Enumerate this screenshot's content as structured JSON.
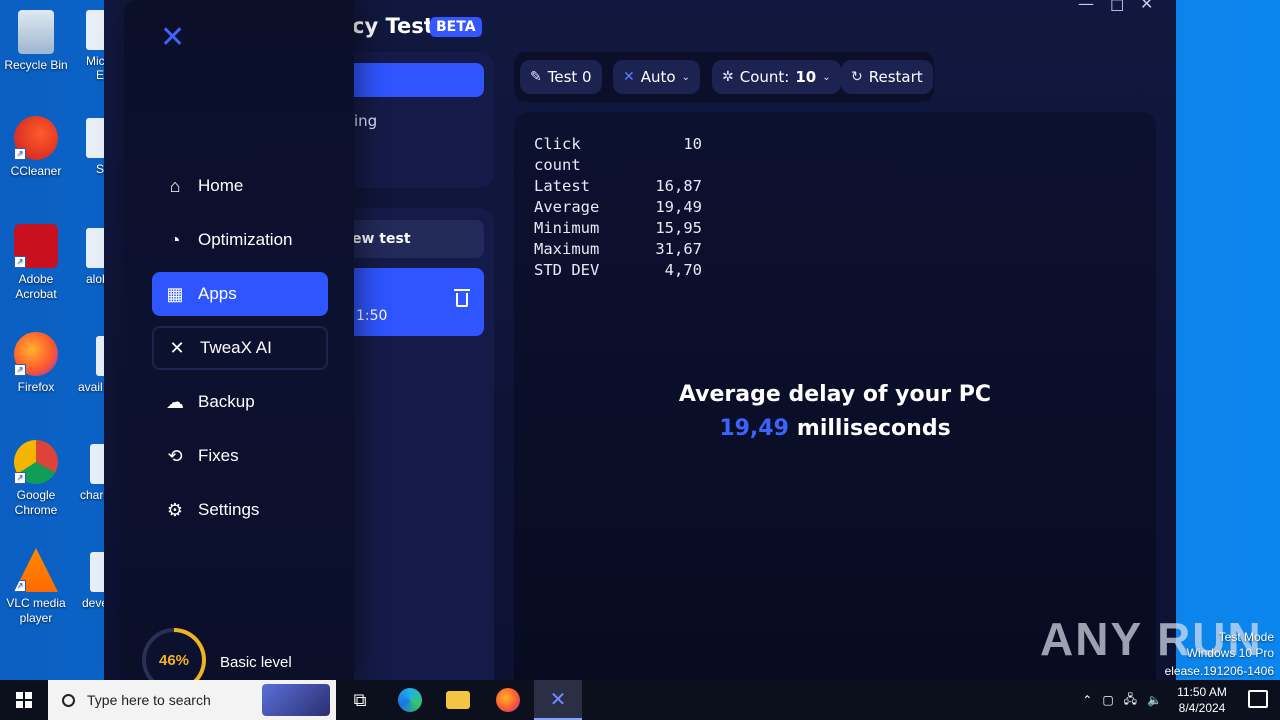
{
  "desktop": {
    "icons": [
      {
        "label": "Recycle Bin"
      },
      {
        "label": "CCleaner"
      },
      {
        "label": "Adobe Acrobat"
      },
      {
        "label": "Firefox"
      },
      {
        "label": "Google Chrome"
      },
      {
        "label": "VLC media player"
      }
    ],
    "partials": [
      "Mic",
      "E",
      "Sl",
      "alob",
      "avail",
      "charg",
      "deve"
    ]
  },
  "app": {
    "title_fragment": "cy Test",
    "beta": "BETA",
    "left_fragment_1": "ing",
    "new_test_fragment": "ew test",
    "test_time_fragment": "1:50",
    "toolbar": {
      "test": "Test 0",
      "auto": "Auto",
      "count_label": "Count:",
      "count_value": "10",
      "restart": "Restart"
    },
    "stats": [
      {
        "k": "Click count",
        "v": "10"
      },
      {
        "k": "Latest",
        "v": "16,87"
      },
      {
        "k": "Average",
        "v": "19,49"
      },
      {
        "k": "Minimum",
        "v": "15,95"
      },
      {
        "k": "Maximum",
        "v": "31,67"
      },
      {
        "k": "STD DEV",
        "v": "4,70"
      }
    ],
    "avg_title": "Average delay of your PC",
    "avg_value": "19,49",
    "avg_unit": "milliseconds"
  },
  "sidebar": {
    "items": [
      {
        "label": "Home",
        "icon": "home-icon"
      },
      {
        "label": "Optimization",
        "icon": "speedometer-icon"
      },
      {
        "label": "Apps",
        "icon": "apps-grid-icon"
      },
      {
        "label": "TweaX AI",
        "icon": "tweax-logo-icon"
      },
      {
        "label": "Backup",
        "icon": "cloud-upload-icon"
      },
      {
        "label": "Fixes",
        "icon": "history-icon"
      },
      {
        "label": "Settings",
        "icon": "gear-icon"
      }
    ],
    "level_percent": "46%",
    "level_fraction": 0.46,
    "level_label": "Basic level"
  },
  "watermark": {
    "text": "ANY RUN",
    "test_mode": "Test Mode",
    "windows": "Windows 10 Pro",
    "build": "elease.191206-1406"
  },
  "taskbar": {
    "search_placeholder": "Type here to search",
    "time": "11:50 AM",
    "date": "8/4/2024"
  },
  "colors": {
    "accent": "#2f55ff",
    "level": "#f0b320",
    "app_bg": "#11183f"
  }
}
